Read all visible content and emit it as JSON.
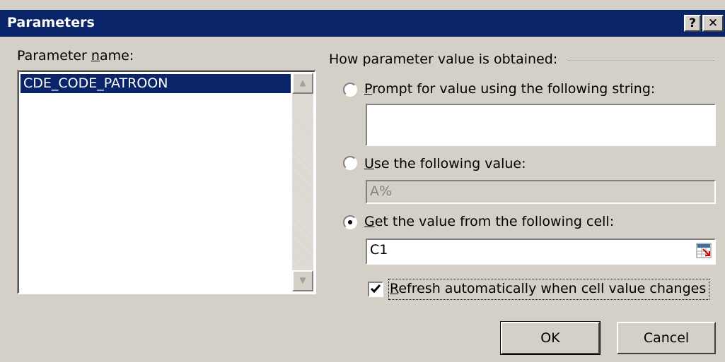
{
  "window": {
    "title": "Parameters",
    "help_label": "?",
    "close_label": "✕"
  },
  "param_list": {
    "label": "Parameter name:",
    "items": [
      "CDE_CODE_PATROON"
    ],
    "scroll_up": "▲",
    "scroll_down": "▼"
  },
  "options": {
    "group_label": "How parameter value is obtained:",
    "prompt": {
      "label": "Prompt for value using the following string:",
      "value": "",
      "selected": false
    },
    "use_value": {
      "label": "Use the following value:",
      "value": "A%",
      "selected": false
    },
    "from_cell": {
      "label": "Get the value from the following cell:",
      "value": "C1",
      "selected": true,
      "ref_icon": "range-select-icon"
    },
    "refresh": {
      "label": "Refresh automatically when cell value changes",
      "checked": true
    }
  },
  "buttons": {
    "ok": "OK",
    "cancel": "Cancel"
  },
  "colors": {
    "titlebar": "#0a246a",
    "selection": "#0a246a",
    "face": "#d4d0c8"
  }
}
